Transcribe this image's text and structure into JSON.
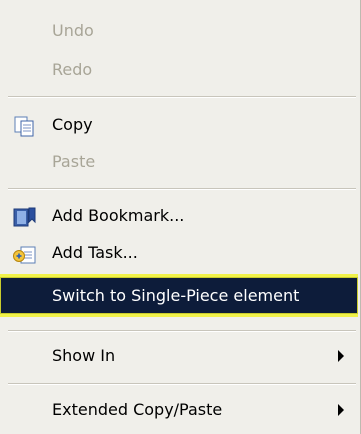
{
  "menu": {
    "items": [
      {
        "label": "Undo",
        "enabled": false
      },
      {
        "label": "Redo",
        "enabled": false
      },
      {
        "label": "Copy",
        "enabled": true,
        "icon": "copy-icon"
      },
      {
        "label": "Paste",
        "enabled": false
      },
      {
        "label": "Add Bookmark...",
        "enabled": true,
        "icon": "bookmark-icon"
      },
      {
        "label": "Add Task...",
        "enabled": true,
        "icon": "task-icon"
      },
      {
        "label": "Switch to Single-Piece element",
        "enabled": true,
        "selected": true
      },
      {
        "label": "Show In",
        "enabled": true,
        "submenu": true
      },
      {
        "label": "Extended Copy/Paste",
        "enabled": true,
        "submenu": true
      }
    ]
  },
  "colors": {
    "menu_background": "#f0efea",
    "disabled_text": "#a8a597",
    "selected_background": "#0d1c3a",
    "highlight_border": "#f1f24a"
  }
}
